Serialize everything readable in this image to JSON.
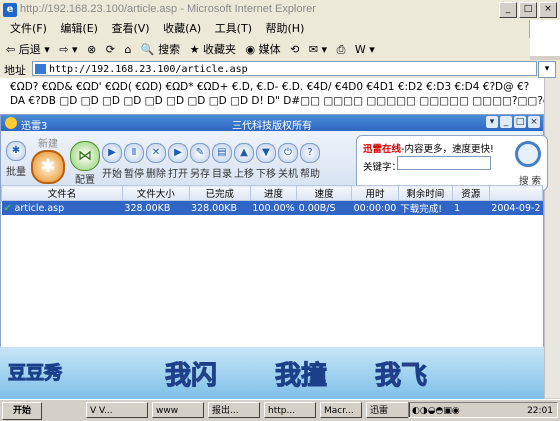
{
  "window": {
    "title": "http://192.168.23.100/article.asp - Microsoft Internet Explorer"
  },
  "menu": [
    "文件(F)",
    "编辑(E)",
    "查看(V)",
    "收藏(A)",
    "工具(T)",
    "帮助(H)"
  ],
  "toolbar": {
    "back": "后退",
    "search": "搜索",
    "favorites": "收藏夹",
    "media": "媒体"
  },
  "address": {
    "label": "地址",
    "url": "http://192.168.23.100/article.asp"
  },
  "page": {
    "line1": "€ΩD? €ΩD& €ΩD' €ΩD( €ΩD) €ΩD* €ΩD+ €.D, €.D- €.D. €4D/ €4D0 €4D1 €:D2 €:D3 €:D4 €?D@ €?",
    "line2": "DA €?DB □D □D □D □D □D □D □D □D □D D! D\" D#□□ □□□□ □□□□□ □□□□□ □□□□?□□?d□ □?_□□□?Z ??g □ ???~ ?o □ ? □?□?□□□?燥□y釦?(□□y釦"
  },
  "xunlei": {
    "title": "迅雷3",
    "subtitle": "三代科技版权所有",
    "buttons": {
      "batch": "批量",
      "new": "新建",
      "config": "配置",
      "start": "开始",
      "pause": "暂停",
      "delete": "删除",
      "open": "打开",
      "saveas": "另存",
      "dir": "目录",
      "up": "上移",
      "down": "下移",
      "shutdown": "关机",
      "help": "帮助"
    },
    "search": {
      "brand": "迅雷在线",
      "slogan": "-内容更多，速度更快!",
      "keyword_label": "关键字：",
      "button": "搜 索"
    },
    "columns": [
      "文件名",
      "文件大小",
      "已完成",
      "进度",
      "速度",
      "用时",
      "剩余时间",
      "资源",
      ""
    ],
    "rows": [
      [
        "article.asp",
        "328.00KB",
        "328.00KB",
        "100.00%",
        "0.00B/S",
        "00:00:00",
        "下载完成!",
        "1",
        "2004-09-2"
      ]
    ],
    "banner": [
      "我闪",
      "我撞",
      "我飞"
    ],
    "banner_logo": "豆豆秀"
  },
  "taskbar": {
    "start": "开始",
    "items": [
      "V V...",
      "www",
      "报出...",
      "http...",
      "Macr...",
      "迅雷"
    ],
    "clock": "22:01"
  }
}
